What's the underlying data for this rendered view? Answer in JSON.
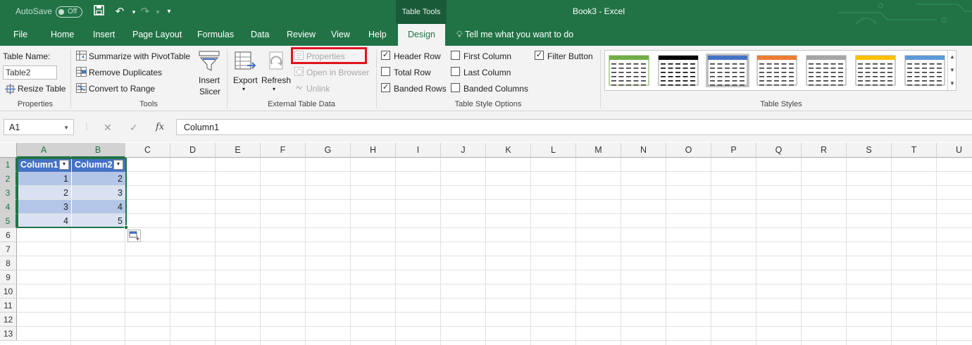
{
  "titlebar": {
    "autosave_label": "AutoSave",
    "autosave_state": "Off",
    "context_tab": "Table Tools",
    "title": "Book3  -  Excel"
  },
  "tabs": {
    "items": [
      "File",
      "Home",
      "Insert",
      "Page Layout",
      "Formulas",
      "Data",
      "Review",
      "View",
      "Help"
    ],
    "active": "Design",
    "tell_me": "Tell me what you want to do"
  },
  "ribbon": {
    "properties_group": {
      "label": "Properties",
      "table_name_label": "Table Name:",
      "table_name_value": "Table2",
      "resize_table": "Resize Table"
    },
    "tools_group": {
      "label": "Tools",
      "summarize": "Summarize with PivotTable",
      "remove_duplicates": "Remove Duplicates",
      "convert_to_range": "Convert to Range",
      "insert_slicer_1": "Insert",
      "insert_slicer_2": "Slicer"
    },
    "external_group": {
      "label": "External Table Data",
      "export": "Export",
      "refresh": "Refresh",
      "properties": "Properties",
      "open_in_browser": "Open in Browser",
      "unlink": "Unlink"
    },
    "style_options_group": {
      "label": "Table Style Options",
      "header_row": "Header Row",
      "total_row": "Total Row",
      "banded_rows": "Banded Rows",
      "first_column": "First Column",
      "last_column": "Last Column",
      "banded_columns": "Banded Columns",
      "filter_button": "Filter Button"
    },
    "styles_group": {
      "label": "Table Styles",
      "swatch_colors": [
        "#70ad47",
        "#000000",
        "#4472c4",
        "#ed7d31",
        "#a5a5a5",
        "#ffc000",
        "#5b9bd5"
      ]
    }
  },
  "formula_bar": {
    "name_box": "A1",
    "cancel_icon": "✕",
    "enter_icon": "✓",
    "fx_label": "fx",
    "formula": "Column1"
  },
  "sheet": {
    "columns": [
      "A",
      "B",
      "C",
      "D",
      "E",
      "F",
      "G",
      "H",
      "I",
      "J",
      "K",
      "L",
      "M",
      "N",
      "O",
      "P",
      "Q",
      "R",
      "S",
      "T",
      "U"
    ],
    "rows": [
      "1",
      "2",
      "3",
      "4",
      "5",
      "6",
      "7",
      "8",
      "9",
      "10",
      "11",
      "12",
      "13"
    ],
    "table_headers": [
      "Column1",
      "Column2"
    ],
    "table_rows": [
      [
        "1",
        "2"
      ],
      [
        "2",
        "3"
      ],
      [
        "3",
        "4"
      ],
      [
        "4",
        "5"
      ]
    ]
  },
  "colors": {
    "excel_green": "#217346",
    "table_header": "#4472c4",
    "band_dark": "#b4c6e7",
    "band_light": "#d9e1f2",
    "highlight_red": "#e0141e"
  }
}
